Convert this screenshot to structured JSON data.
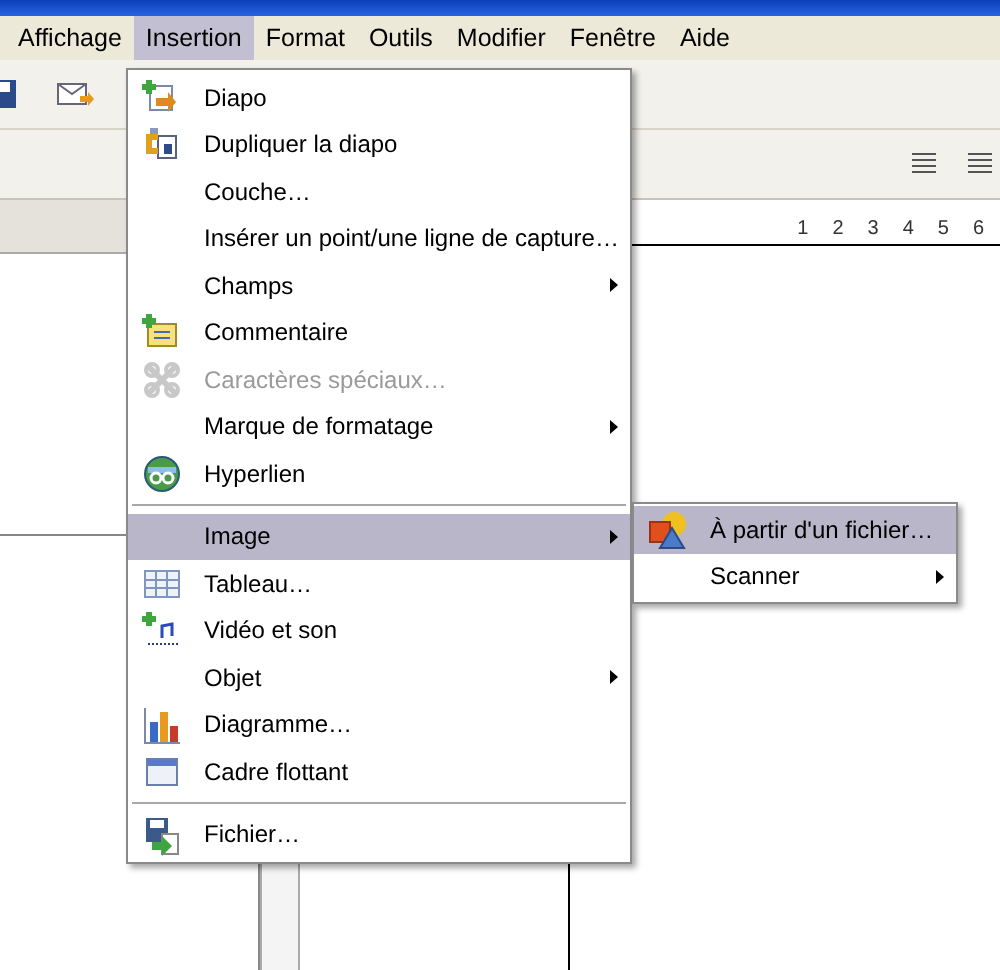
{
  "menubar": [
    {
      "label": "Affichage",
      "selected": false
    },
    {
      "label": "Insertion",
      "selected": true
    },
    {
      "label": "Format",
      "selected": false
    },
    {
      "label": "Outils",
      "selected": false
    },
    {
      "label": "Modifier",
      "selected": false
    },
    {
      "label": "Fenêtre",
      "selected": false
    },
    {
      "label": "Aide",
      "selected": false
    }
  ],
  "ruler": {
    "marks": [
      "1",
      "2",
      "3",
      "4",
      "5",
      "6"
    ]
  },
  "menu": {
    "items": [
      {
        "kind": "item",
        "label": "Diapo",
        "submenu": false,
        "disabled": false,
        "selected": false
      },
      {
        "kind": "item",
        "label": "Dupliquer la diapo",
        "submenu": false,
        "disabled": false,
        "selected": false
      },
      {
        "kind": "item",
        "label": "Couche…",
        "submenu": false,
        "disabled": false,
        "selected": false
      },
      {
        "kind": "item",
        "label": "Insérer un point/une ligne de capture…",
        "submenu": false,
        "disabled": false,
        "selected": false
      },
      {
        "kind": "item",
        "label": "Champs",
        "submenu": true,
        "disabled": false,
        "selected": false
      },
      {
        "kind": "item",
        "label": "Commentaire",
        "submenu": false,
        "disabled": false,
        "selected": false
      },
      {
        "kind": "item",
        "label": "Caractères spéciaux…",
        "submenu": false,
        "disabled": true,
        "selected": false
      },
      {
        "kind": "item",
        "label": "Marque de formatage",
        "submenu": true,
        "disabled": false,
        "selected": false
      },
      {
        "kind": "item",
        "label": "Hyperlien",
        "submenu": false,
        "disabled": false,
        "selected": false
      },
      {
        "kind": "separator"
      },
      {
        "kind": "item",
        "label": "Image",
        "submenu": true,
        "disabled": false,
        "selected": true
      },
      {
        "kind": "item",
        "label": "Tableau…",
        "submenu": false,
        "disabled": false,
        "selected": false
      },
      {
        "kind": "item",
        "label": "Vidéo et son",
        "submenu": false,
        "disabled": false,
        "selected": false
      },
      {
        "kind": "item",
        "label": "Objet",
        "submenu": true,
        "disabled": false,
        "selected": false
      },
      {
        "kind": "item",
        "label": "Diagramme…",
        "submenu": false,
        "disabled": false,
        "selected": false
      },
      {
        "kind": "item",
        "label": "Cadre flottant",
        "submenu": false,
        "disabled": false,
        "selected": false
      },
      {
        "kind": "separator"
      },
      {
        "kind": "item",
        "label": "Fichier…",
        "submenu": false,
        "disabled": false,
        "selected": false
      }
    ]
  },
  "submenu": {
    "items": [
      {
        "label": "À partir d'un fichier…",
        "submenu": false,
        "selected": true
      },
      {
        "label": "Scanner",
        "submenu": true,
        "selected": false
      }
    ]
  }
}
